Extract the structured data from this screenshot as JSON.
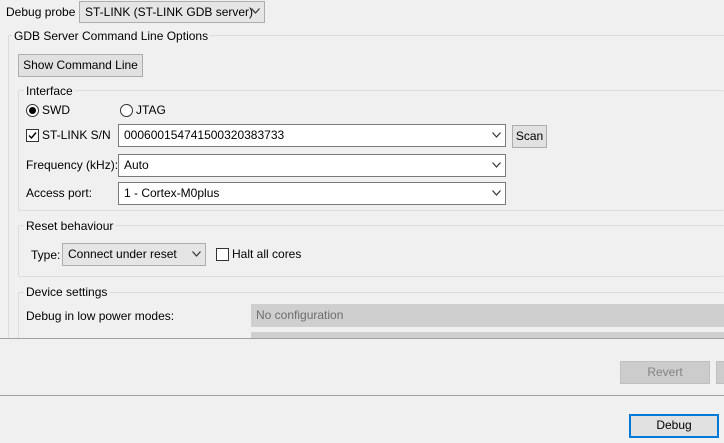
{
  "debug_probe": {
    "label": "Debug probe",
    "value": "ST-LINK (ST-LINK GDB server)"
  },
  "gdb_server": {
    "group_title": "GDB Server Command Line Options",
    "show_command_line": "Show Command Line"
  },
  "interface": {
    "group_title": "Interface",
    "swd_label": "SWD",
    "swd_selected": true,
    "jtag_label": "JTAG",
    "jtag_selected": false,
    "stlink_sn_label": "ST-LINK S/N",
    "stlink_sn_checked": true,
    "stlink_sn_value": "0006001547415003203837​33",
    "scan_label": "Scan",
    "frequency_label": "Frequency (kHz):",
    "frequency_value": "Auto",
    "access_port_label": "Access port:",
    "access_port_value": "1 - Cortex-M0plus"
  },
  "reset": {
    "group_title": "Reset behaviour",
    "type_label": "Type:",
    "type_value": "Connect under reset",
    "halt_all_cores_label": "Halt all cores",
    "halt_all_cores_checked": false
  },
  "device": {
    "group_title": "Device settings",
    "low_power_label": "Debug in low power modes:",
    "low_power_value": "No configuration"
  },
  "footer": {
    "revert_label": "Revert",
    "debug_label": "Debug"
  },
  "colors": {
    "background": "#f0f0f0",
    "default_button_border": "#0078d7",
    "disabled_field": "#cfcfcf"
  }
}
